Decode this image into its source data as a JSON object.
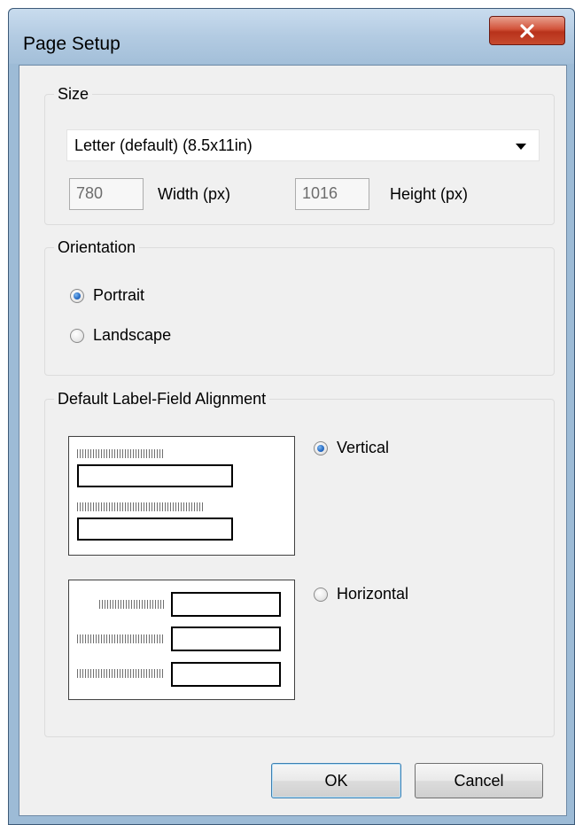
{
  "window": {
    "title": "Page Setup",
    "close_icon": "close-icon"
  },
  "size": {
    "legend": "Size",
    "paper_selected": "Letter (default) (8.5x11in)",
    "width_value": "780",
    "width_label": "Width (px)",
    "height_value": "1016",
    "height_label": "Height (px)"
  },
  "orientation": {
    "legend": "Orientation",
    "options": [
      {
        "label": "Portrait",
        "selected": true
      },
      {
        "label": "Landscape",
        "selected": false
      }
    ]
  },
  "alignment": {
    "legend": "Default Label-Field Alignment",
    "options": [
      {
        "label": "Vertical",
        "selected": true
      },
      {
        "label": "Horizontal",
        "selected": false
      }
    ]
  },
  "buttons": {
    "ok": "OK",
    "cancel": "Cancel"
  },
  "colors": {
    "title_bar": "#b3cbe2",
    "close_button": "#c74a2e",
    "dialog_background": "#f0f0f0",
    "radio_selected": "#2b6fc7"
  }
}
